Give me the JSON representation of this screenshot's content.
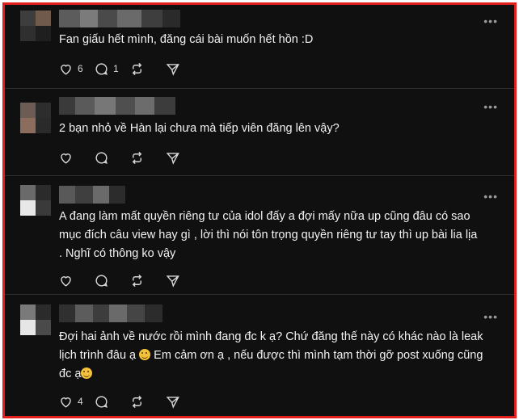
{
  "posts": [
    {
      "text": "Fan giấu hết mình, đăng cái bài muốn hết hồn :D",
      "likes": "6",
      "replies": "1",
      "reposts": "",
      "shares": ""
    },
    {
      "text": "2 bạn nhỏ về Hàn lại chưa mà tiếp viên đăng lên vậy?",
      "likes": "",
      "replies": "",
      "reposts": "",
      "shares": ""
    },
    {
      "text_line1": "A đang làm mất quyền riêng tư của idol đấy a đợi mấy nữa up cũng đâu có sao",
      "text_line2": "mục đích câu view hay gì , lời thì nói tôn trọng quyền riêng tư tay thì up bài lia lịa",
      "text_line3": ". Nghĩ có thông ko vậy",
      "likes": "",
      "replies": "",
      "reposts": "",
      "shares": ""
    },
    {
      "text_line1": "Đợi hai ảnh về nước rồi mình đang đc k ạ? Chứ đăng thế này có khác nào là leak",
      "text_line2a": "lịch trình đâu ạ ",
      "text_line2b": " Em cảm ơn ạ , nếu được thì mình tạm thời gỡ post xuống cũng",
      "text_line3": "đc ạ",
      "likes": "4",
      "replies": "",
      "reposts": "",
      "shares": ""
    }
  ],
  "icons": {
    "like": "heart-icon",
    "reply": "comment-icon",
    "repost": "repost-icon",
    "share": "send-icon",
    "more": "more-options-icon",
    "emoji": "smiling-face-emoji"
  },
  "more_label": "•••",
  "colors": {
    "background": "#101010",
    "text": "#f2f2f2",
    "icon": "#d8d8d8",
    "divider": "#2e2e2e",
    "frame_border": "#e3201b"
  }
}
